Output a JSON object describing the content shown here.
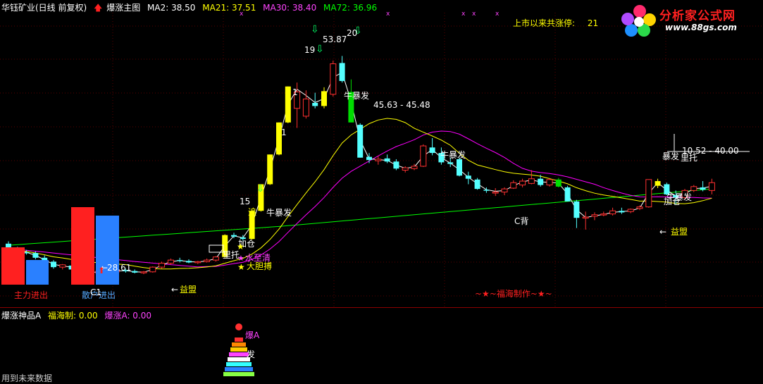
{
  "header": {
    "stock": "华钰矿业(日线 前复权)",
    "indicator": "爆涨主图",
    "ma2": "MA2: 38.50",
    "ma21": "MA21: 37.51",
    "ma30": "MA30: 38.40",
    "ma72": "MA72: 36.96"
  },
  "colors": {
    "ma2": "#ffffff",
    "ma21": "#ffff00",
    "ma30": "#ff00ff",
    "ma72": "#00ff00",
    "up": "#ff3030",
    "down": "#54ffff",
    "strong": "#ffff00",
    "brand": "#ff2020"
  },
  "right_info": {
    "label": "上市以来共涨停:",
    "value": "21"
  },
  "logo": {
    "title": "分析家公式网",
    "url": "www.88gs.com"
  },
  "labels": {
    "p5387": "53.87",
    "range1": "45.63 - 45.48",
    "range2": "10.52 - 40.00",
    "p2861": "28.61",
    "n19": "19",
    "n20": "20",
    "n15": "15",
    "n1a": "1",
    "n1b": "1",
    "zhui": "追",
    "niubao1": "牛暴发",
    "niubao2": "牛暴发",
    "niubao3": "牛暴发",
    "niubao4": "牛暴发",
    "niubao5": "暴发",
    "jiacang1": "加仓",
    "jiacang2": "加仓",
    "jiacang3": "加仓",
    "liaotuo1": "里托",
    "liaotuo2": "里托",
    "shuilao": "水至清",
    "dadan": "大胆搏",
    "cbei": "C背",
    "yimeng1": "益盟",
    "yimeng2": "益盟",
    "zhuli": "主力进出",
    "sanhu": "散户进出",
    "c1": "C1",
    "fuhai": "~★~福海制作~★~"
  },
  "lower": {
    "title": "爆涨神品A",
    "fuhai": "福海制: 0.00",
    "baozhang": "爆涨A: 0.00",
    "baoA": "爆A",
    "fa": "发",
    "note": "用到未来数据"
  },
  "chart_data": {
    "type": "candlestick",
    "series": [
      {
        "o": 30.2,
        "h": 30.5,
        "l": 29.2,
        "c": 29.4
      },
      {
        "o": 29.4,
        "h": 29.8,
        "l": 29.0,
        "c": 29.2
      },
      {
        "o": 29.1,
        "h": 29.4,
        "l": 28.8,
        "c": 29.0
      },
      {
        "o": 29.0,
        "h": 29.2,
        "l": 28.2,
        "c": 28.4
      },
      {
        "o": 28.4,
        "h": 28.7,
        "l": 27.6,
        "c": 27.9
      },
      {
        "o": 27.9,
        "h": 28.1,
        "l": 27.0,
        "c": 27.2
      },
      {
        "o": 27.2,
        "h": 27.6,
        "l": 26.9,
        "c": 27.5
      },
      {
        "o": 27.4,
        "h": 27.5,
        "l": 26.7,
        "c": 26.9
      },
      {
        "o": 26.9,
        "h": 27.1,
        "l": 26.5,
        "c": 26.7
      },
      {
        "o": 26.6,
        "h": 26.9,
        "l": 26.2,
        "c": 26.4
      },
      {
        "o": 26.4,
        "h": 26.8,
        "l": 26.1,
        "c": 26.7
      },
      {
        "o": 26.7,
        "h": 27.0,
        "l": 26.4,
        "c": 26.6
      },
      {
        "o": 26.6,
        "h": 26.9,
        "l": 26.4,
        "c": 26.8
      },
      {
        "o": 26.8,
        "h": 27.0,
        "l": 26.5,
        "c": 26.7
      },
      {
        "o": 26.7,
        "h": 26.9,
        "l": 26.4,
        "c": 26.5
      },
      {
        "o": 26.5,
        "h": 26.7,
        "l": 26.3,
        "c": 26.6
      },
      {
        "o": 26.6,
        "h": 27.3,
        "l": 26.5,
        "c": 27.2
      },
      {
        "o": 27.2,
        "h": 27.9,
        "l": 27.0,
        "c": 27.7
      },
      {
        "o": 27.7,
        "h": 28.3,
        "l": 27.5,
        "c": 28.1
      },
      {
        "o": 28.1,
        "h": 28.4,
        "l": 27.8,
        "c": 28.0
      },
      {
        "o": 28.0,
        "h": 28.2,
        "l": 27.7,
        "c": 27.8
      },
      {
        "o": 27.8,
        "h": 28.0,
        "l": 27.6,
        "c": 27.9
      },
      {
        "o": 27.9,
        "h": 28.3,
        "l": 27.8,
        "c": 28.1
      },
      {
        "o": 28.1,
        "h": 28.6,
        "l": 27.9,
        "c": 28.5
      },
      {
        "o": 28.5,
        "h": 31.4,
        "l": 28.4,
        "c": 31.3
      },
      {
        "o": 31.3,
        "h": 31.6,
        "l": 30.9,
        "c": 31.1
      },
      {
        "o": 31.0,
        "h": 31.3,
        "l": 30.6,
        "c": 30.8
      },
      {
        "o": 30.8,
        "h": 34.4,
        "l": 30.7,
        "c": 34.4
      },
      {
        "o": 34.4,
        "h": 37.8,
        "l": 34.3,
        "c": 37.8
      },
      {
        "o": 37.8,
        "h": 41.6,
        "l": 37.7,
        "c": 41.6
      },
      {
        "o": 41.6,
        "h": 45.7,
        "l": 41.5,
        "c": 45.7
      },
      {
        "o": 45.7,
        "h": 50.3,
        "l": 45.6,
        "c": 50.3
      },
      {
        "o": 47.5,
        "h": 50.8,
        "l": 45.0,
        "c": 49.6
      },
      {
        "o": 46.5,
        "h": 49.8,
        "l": 46.2,
        "c": 48.7
      },
      {
        "o": 48.2,
        "h": 49.5,
        "l": 47.5,
        "c": 47.8
      },
      {
        "o": 47.8,
        "h": 50.2,
        "l": 47.5,
        "c": 49.7
      },
      {
        "o": 49.3,
        "h": 53.6,
        "l": 49.0,
        "c": 53.2
      },
      {
        "o": 53.3,
        "h": 54.2,
        "l": 50.8,
        "c": 51.0
      },
      {
        "o": 49.6,
        "h": 51.2,
        "l": 45.8,
        "c": 45.7
      },
      {
        "o": 45.4,
        "h": 45.6,
        "l": 41.2,
        "c": 41.2
      },
      {
        "o": 41.3,
        "h": 41.8,
        "l": 40.5,
        "c": 40.9
      },
      {
        "o": 40.8,
        "h": 41.4,
        "l": 40.3,
        "c": 41.0
      },
      {
        "o": 41.1,
        "h": 41.6,
        "l": 40.5,
        "c": 40.7
      },
      {
        "o": 40.7,
        "h": 41.0,
        "l": 39.6,
        "c": 39.8
      },
      {
        "o": 39.6,
        "h": 40.1,
        "l": 39.3,
        "c": 39.9
      },
      {
        "o": 39.8,
        "h": 40.4,
        "l": 39.6,
        "c": 40.1
      },
      {
        "o": 40.1,
        "h": 42.9,
        "l": 40.0,
        "c": 42.7
      },
      {
        "o": 42.5,
        "h": 43.7,
        "l": 41.5,
        "c": 41.8
      },
      {
        "o": 41.8,
        "h": 42.5,
        "l": 40.3,
        "c": 40.6
      },
      {
        "o": 40.6,
        "h": 41.2,
        "l": 40.0,
        "c": 40.4
      },
      {
        "o": 41.0,
        "h": 41.2,
        "l": 38.8,
        "c": 38.9
      },
      {
        "o": 38.9,
        "h": 39.4,
        "l": 37.8,
        "c": 38.5
      },
      {
        "o": 38.4,
        "h": 38.6,
        "l": 37.1,
        "c": 37.2
      },
      {
        "o": 37.1,
        "h": 37.4,
        "l": 36.7,
        "c": 37.0
      },
      {
        "o": 36.8,
        "h": 37.3,
        "l": 36.3,
        "c": 36.8
      },
      {
        "o": 36.8,
        "h": 37.4,
        "l": 36.4,
        "c": 37.2
      },
      {
        "o": 37.3,
        "h": 38.3,
        "l": 37.2,
        "c": 38.0
      },
      {
        "o": 37.7,
        "h": 38.5,
        "l": 37.4,
        "c": 38.2
      },
      {
        "o": 37.9,
        "h": 39.6,
        "l": 37.8,
        "c": 38.5
      },
      {
        "o": 38.5,
        "h": 39.0,
        "l": 37.5,
        "c": 37.7
      },
      {
        "o": 37.7,
        "h": 38.6,
        "l": 37.5,
        "c": 38.4
      },
      {
        "o": 38.4,
        "h": 38.6,
        "l": 37.4,
        "c": 37.5
      },
      {
        "o": 37.4,
        "h": 37.6,
        "l": 35.6,
        "c": 35.6
      },
      {
        "o": 35.6,
        "h": 35.8,
        "l": 32.2,
        "c": 33.5
      },
      {
        "o": 33.5,
        "h": 34.3,
        "l": 32.0,
        "c": 33.6
      },
      {
        "o": 33.7,
        "h": 34.2,
        "l": 33.2,
        "c": 33.9
      },
      {
        "o": 33.9,
        "h": 34.3,
        "l": 33.7,
        "c": 34.0
      },
      {
        "o": 34.0,
        "h": 34.8,
        "l": 33.8,
        "c": 34.4
      },
      {
        "o": 34.4,
        "h": 34.8,
        "l": 34.0,
        "c": 34.2
      },
      {
        "o": 34.3,
        "h": 34.7,
        "l": 34.1,
        "c": 34.6
      },
      {
        "o": 34.7,
        "h": 35.1,
        "l": 34.5,
        "c": 34.9
      },
      {
        "o": 34.9,
        "h": 38.4,
        "l": 34.8,
        "c": 38.4
      },
      {
        "o": 38.2,
        "h": 38.5,
        "l": 37.3,
        "c": 37.6
      },
      {
        "o": 37.8,
        "h": 38.0,
        "l": 36.4,
        "c": 36.5
      },
      {
        "o": 36.4,
        "h": 37.0,
        "l": 35.2,
        "c": 36.1
      },
      {
        "o": 36.1,
        "h": 37.2,
        "l": 35.9,
        "c": 37.0
      },
      {
        "o": 37.0,
        "h": 37.7,
        "l": 36.8,
        "c": 37.5
      },
      {
        "o": 37.4,
        "h": 38.2,
        "l": 36.9,
        "c": 37.1
      },
      {
        "o": 37.0,
        "h": 38.5,
        "l": 36.5,
        "c": 38.0
      }
    ]
  }
}
